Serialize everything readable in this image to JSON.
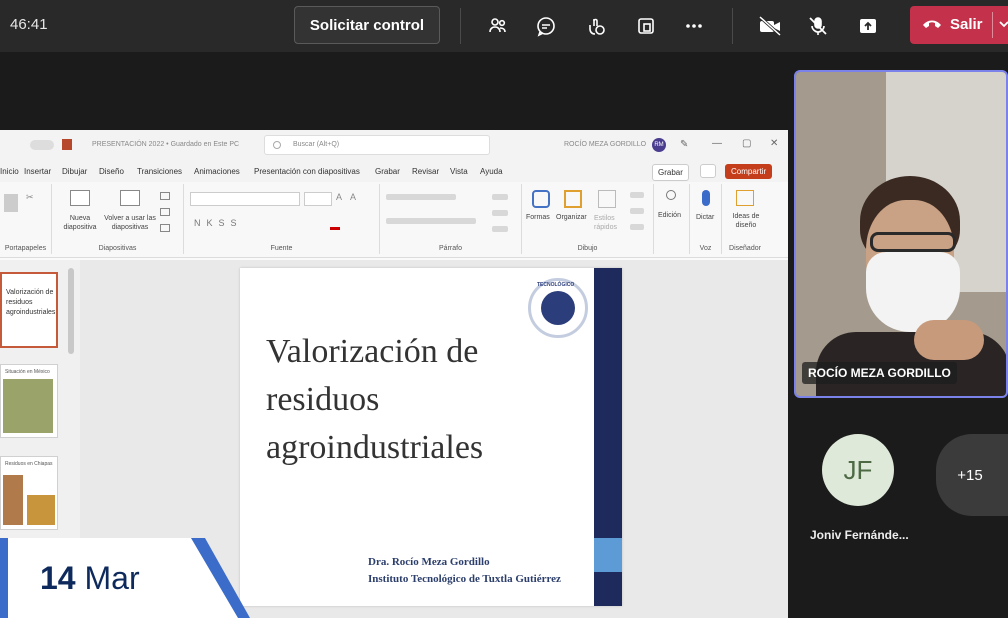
{
  "meeting": {
    "timer": "46:41",
    "request_control_label": "Solicitar control",
    "leave_label": "Salir",
    "icons": [
      "people-icon",
      "chat-icon",
      "reactions-icon",
      "view-icon",
      "more-icon",
      "camera-off-icon",
      "mic-off-icon",
      "share-icon",
      "phone-icon",
      "chevron-down-icon"
    ]
  },
  "powerpoint": {
    "titlebar": {
      "file": "PRESENTACIÓN 2022 • Guardado en Este PC",
      "search": "Buscar (Alt+Q)",
      "user": "ROCÍO MEZA GORDILLO",
      "initials": "RM"
    },
    "menu_tabs": [
      "Inicio",
      "Insertar",
      "Dibujar",
      "Diseño",
      "Transiciones",
      "Animaciones",
      "Presentación con diapositivas",
      "Grabar",
      "Revisar",
      "Vista",
      "Ayuda"
    ],
    "record_btn": "Grabar",
    "share_btn": "Compartir",
    "ribbon": {
      "new_slide": "Nueva diapositiva",
      "reuse": "Volver a usar las diapositivas",
      "groups": [
        "Portapapeles",
        "Diapositivas",
        "Fuente",
        "Párrafo",
        "Dibujo",
        "Voz",
        "Diseñador"
      ],
      "shapes": "Formas",
      "arrange": "Organizar",
      "styles": "Estilos rápidos",
      "edit": "Edición",
      "dictate": "Dictar",
      "designer": "Ideas de diseño"
    },
    "thumbs": [
      {
        "title": "Valorización de residuos agroindustriales"
      },
      {
        "title": "Situación en México"
      },
      {
        "title": "Residuos en Chiapas"
      }
    ]
  },
  "slide": {
    "title_lines": [
      "Valorización de",
      "residuos",
      "agroindustriales"
    ],
    "author": "Dra. Rocío Meza Gordillo",
    "institution": "Instituto Tecnológico de Tuxtla Gutiérrez",
    "seal_text": "TECNOLÓGICO"
  },
  "date_banner": {
    "day": "14",
    "month": "Mar"
  },
  "participants": {
    "presenter_name": "ROCÍO MEZA GORDILLO",
    "jf_initials": "JF",
    "jf_name": "Joniv Fernánde...",
    "more_count": "+15"
  },
  "colors": {
    "accent": "#7b83eb",
    "leave": "#c4314b",
    "slide_bar": "#1f2a5c",
    "banner_blue": "#3b6cc9"
  }
}
